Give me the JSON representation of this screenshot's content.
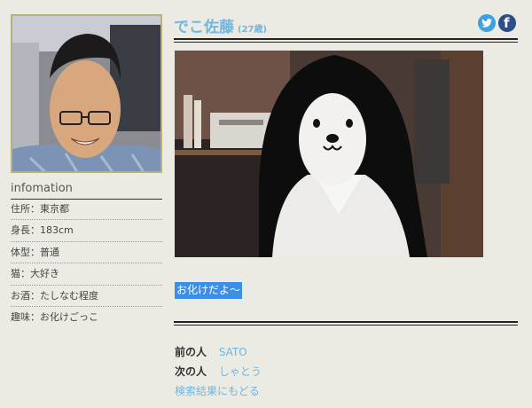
{
  "profile": {
    "name": "でこ佐藤",
    "age": "(27歳)"
  },
  "info": {
    "heading": "infomation",
    "items": [
      "住所：東京都",
      "身長：183cm",
      "体型：普通",
      "猫：大好き",
      "お酒：たしなむ程度",
      "趣味：お化けごっこ"
    ]
  },
  "post": {
    "caption": "お化けだよ〜"
  },
  "nav": {
    "prev_label": "前の人",
    "prev_link": "SATO",
    "next_label": "次の人",
    "next_link": "しゃとう",
    "back_link": "検索結果にもどる"
  },
  "social": {
    "icons": [
      "twitter-icon",
      "facebook-icon"
    ]
  },
  "colors": {
    "accent": "#6fb6e0",
    "background": "#ecebe3",
    "caption_highlight": "#3c8ee8"
  }
}
